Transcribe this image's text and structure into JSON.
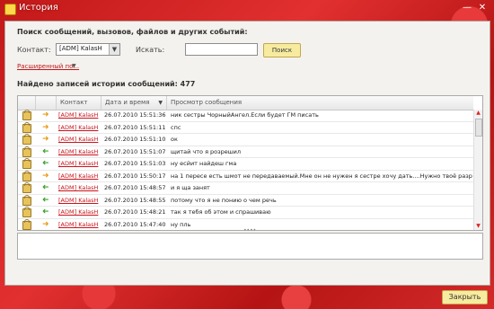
{
  "window": {
    "title": "История"
  },
  "search": {
    "title": "Поиск сообщений, вызовов, файлов и других событий:",
    "contact_label": "Контакт:",
    "contact_value": "[ADM] KalasH",
    "search_label": "Искать:",
    "search_value": "",
    "search_button": "Поиск",
    "advanced_link": "Расширенный по..."
  },
  "results": {
    "found_text": "Найдено записей истории сообщений: 477"
  },
  "table": {
    "columns": [
      "Контакт",
      "Дата и время",
      "Просмотр сообщения"
    ],
    "rows": [
      {
        "direction": "out",
        "contact": "[ADM] KalasH",
        "datetime": "26.07.2010 15:51:36",
        "message": "ник сестры ЧорныйАнгел.Если будет  ГМ писать"
      },
      {
        "direction": "out",
        "contact": "[ADM] KalasH",
        "datetime": "26.07.2010 15:51:11",
        "message": "спс"
      },
      {
        "direction": "out",
        "contact": "[ADM] KalasH",
        "datetime": "26.07.2010 15:51:10",
        "message": "ок"
      },
      {
        "direction": "in",
        "contact": "[ADM] KalasH",
        "datetime": "26.07.2010 15:51:07",
        "message": "щитай что я розрешил"
      },
      {
        "direction": "in",
        "contact": "[ADM] KalasH",
        "datetime": "26.07.2010 15:51:03",
        "message": "ну есйит найдеш гма"
      },
      {
        "direction": "out",
        "contact": "[ADM] KalasH",
        "datetime": "26.07.2010 15:50:17",
        "message": "на 1 пересе есть шмот не передаваемый.Мне он не нужен я сестре хочу дать....Нужно твоё разрешение"
      },
      {
        "direction": "in",
        "contact": "[ADM] KalasH",
        "datetime": "26.07.2010 15:48:57",
        "message": "и я ща занят"
      },
      {
        "direction": "in",
        "contact": "[ADM] KalasH",
        "datetime": "26.07.2010 15:48:55",
        "message": "потому что я не понию о чем речь"
      },
      {
        "direction": "in",
        "contact": "[ADM] KalasH",
        "datetime": "26.07.2010 15:48:21",
        "message": "так я тебя об этом и спрашиваю"
      },
      {
        "direction": "out",
        "contact": "[ADM] KalasH",
        "datetime": "26.07.2010 15:47:40",
        "message": "ну пль"
      }
    ]
  },
  "footer": {
    "close_button": "Закрыть"
  },
  "colors": {
    "link": "#c8141b",
    "outgoing_arrow": "#e79a16",
    "incoming_arrow": "#3aa12a"
  }
}
